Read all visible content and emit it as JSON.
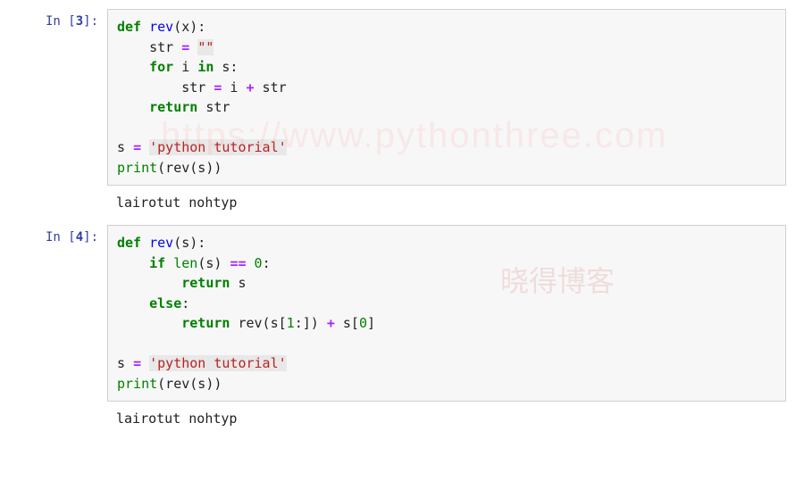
{
  "watermarks": {
    "url": "https://www.pythonthree.com",
    "blog": "晓得博客"
  },
  "cells": [
    {
      "prompt_prefix": "In [",
      "prompt_num": "3",
      "prompt_suffix": "]:",
      "tokens": {
        "def": "def",
        "fn": "rev",
        "param": "(x):",
        "l2a": "    str ",
        "eq": "=",
        "l2b": " ",
        "str_empty": "\"\"",
        "l3a": "    ",
        "for": "for",
        "l3b": " i ",
        "in": "in",
        "l3c": " s:",
        "l4a": "        str ",
        "l4b": " i ",
        "plus": "+",
        "l4c": " str",
        "l5a": "    ",
        "return": "return",
        "l5b": " str",
        "l6": "",
        "l7a": "s ",
        "l7b": " ",
        "str_lit": "'python tutorial'",
        "l8a": "print",
        "l8b": "(rev(s))"
      },
      "output": "lairotut nohtyp"
    },
    {
      "prompt_prefix": "In [",
      "prompt_num": "4",
      "prompt_suffix": "]:",
      "tokens": {
        "def": "def",
        "fn": "rev",
        "param": "(s):",
        "l2a": "    ",
        "if": "if",
        "l2b": " ",
        "len": "len",
        "l2c": "(s) ",
        "eqeq": "==",
        "l2d": " ",
        "zero": "0",
        "l2e": ":",
        "l3a": "        ",
        "return": "return",
        "l3b": " s",
        "l4a": "    ",
        "else": "else",
        "l4b": ":",
        "l5a": "        ",
        "l5b": " rev(s[",
        "one": "1",
        "l5c": ":]) ",
        "plus": "+",
        "l5d": " s[",
        "zero2": "0",
        "l5e": "]",
        "l6": "",
        "l7a": "s ",
        "eq": "=",
        "l7b": " ",
        "str_lit": "'python tutorial'",
        "l8a": "print",
        "l8b": "(rev(s))"
      },
      "output": "lairotut nohtyp"
    }
  ]
}
